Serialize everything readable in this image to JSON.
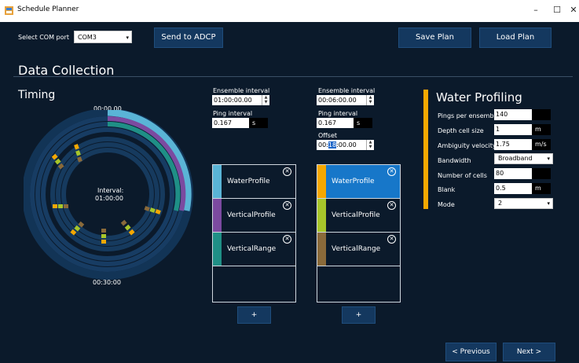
{
  "window": {
    "title": "Schedule Planner",
    "minimize": "–",
    "maximize": "☐",
    "close": "✕"
  },
  "toolbar": {
    "com_label": "Select COM port",
    "com_value": "COM3",
    "send_label": "Send to ADCP",
    "save_label": "Save Plan",
    "load_label": "Load Plan"
  },
  "section": {
    "title": "Data Collection"
  },
  "timing": {
    "title": "Timing",
    "top_time": "00:00.00",
    "bottom_time": "00:30:00",
    "center_label": "Interval:",
    "center_value": "01:00:00"
  },
  "group1": {
    "ensemble_label": "Ensemble interval",
    "ensemble_value": "01:00:00.00",
    "ping_label": "Ping interval",
    "ping_value": "0.167",
    "ping_unit": "s",
    "items": [
      {
        "name": "WaterProfile",
        "color": "#5ab4d6"
      },
      {
        "name": "VerticalProfile",
        "color": "#7b4aa0"
      },
      {
        "name": "VerticalRange",
        "color": "#1f8f86"
      }
    ],
    "add_label": "+"
  },
  "group2": {
    "ensemble_label": "Ensemble interval",
    "ensemble_value": "00:06:00.00",
    "ping_label": "Ping interval",
    "ping_value": "0.167",
    "ping_unit": "s",
    "offset_label": "Offset",
    "offset_value_pre": "00:",
    "offset_value_sel": "18",
    "offset_value_post": ":00.00",
    "items": [
      {
        "name": "WaterProfile",
        "color": "#f5a800"
      },
      {
        "name": "VerticalProfile",
        "color": "#a7c62a"
      },
      {
        "name": "VerticalRange",
        "color": "#8a6a3a"
      }
    ],
    "add_label": "+"
  },
  "water_profiling": {
    "title": "Water Profiling",
    "fields": {
      "pings_label": "Pings per ensemble",
      "pings_value": "140",
      "depth_label": "Depth cell size",
      "depth_value": "1",
      "depth_unit": "m",
      "ambig_label": "Ambiguity velocity",
      "ambig_value": "1.75",
      "ambig_unit": "m/s",
      "bandwidth_label": "Bandwidth",
      "bandwidth_value": "Broadband",
      "cells_label": "Number of cells",
      "cells_value": "80",
      "blank_label": "Blank",
      "blank_value": "0.5",
      "blank_unit": "m",
      "mode_label": "Mode",
      "mode_value": "2"
    }
  },
  "nav": {
    "previous_label": "< Previous",
    "next_label": "Next >"
  },
  "colors": {
    "background": "#0b1a2b",
    "button": "#14385f",
    "selected_item": "#1777c9",
    "accent": "#f5a800"
  }
}
